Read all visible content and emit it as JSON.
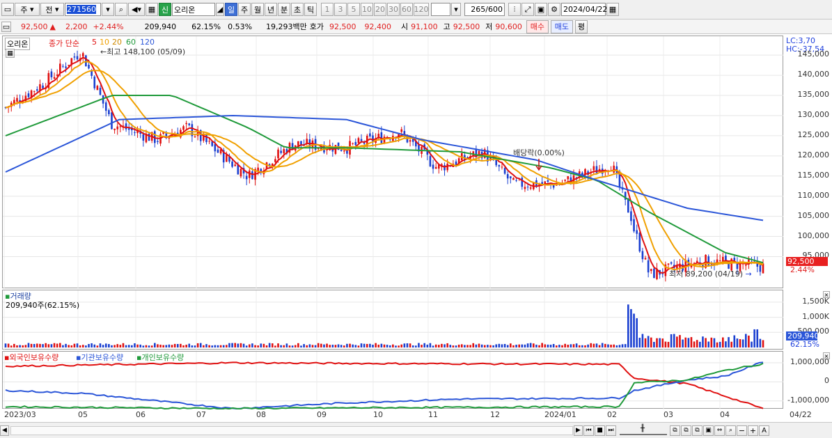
{
  "toolbar": {
    "period_label": "주",
    "prev_label": "전",
    "code": "271560",
    "credit_badge": "신",
    "stock_name": "오리온",
    "periods": [
      "일",
      "주",
      "월",
      "년",
      "분",
      "초",
      "틱"
    ],
    "active_period": "일",
    "intervals": [
      "1",
      "3",
      "5",
      "10",
      "20",
      "30",
      "60",
      "120"
    ],
    "count_value": "265",
    "count_total": "/600",
    "date": "2024/04/22"
  },
  "info": {
    "price": "92,500",
    "change_arrow": "▲",
    "change": "2,200",
    "change_pct": "+2.44%",
    "volume": "209,940",
    "turnover": "62.15%",
    "ratio": "0.53%",
    "amount": "19,293백만",
    "quote_label": "호가",
    "ask": "92,500",
    "bid": "92,400",
    "open_label": "시",
    "open": "91,100",
    "high_label": "고",
    "high": "92,500",
    "low_label": "저",
    "low": "90,600",
    "buy_button": "매수",
    "sell_button": "매도",
    "eval_button": "평"
  },
  "price_pane": {
    "name_tab": "오리온",
    "legend_prefix": "종가 단순",
    "ma_periods": [
      "5",
      "10",
      "20",
      "60",
      "120"
    ],
    "ma_colors": [
      "#e01010",
      "#f0a000",
      "#f0a000",
      "#1f9a3a",
      "#2a55d8"
    ],
    "high_note": "최고 148,100 (05/09)",
    "low_note": "최저 89,200 (04/19)",
    "dividend_note": "배당락(0.00%)",
    "lc": "LC:3,70",
    "hc": "HC:-37,54",
    "last_price_tag": "92,500",
    "last_pct_tag": "2.44%",
    "y_labels": [
      "145,000",
      "140,000",
      "135,000",
      "130,000",
      "125,000",
      "120,000",
      "115,000",
      "110,000",
      "105,000",
      "100,000",
      "95,000"
    ]
  },
  "volume_pane": {
    "title": "거래량",
    "value_note": "209,940주(62.15%)",
    "y_labels": [
      "1,500K",
      "1,000K",
      "500,000"
    ],
    "last_tag": "209,940",
    "pct_tag": "62.15%"
  },
  "holdings_pane": {
    "legends": [
      "외국인보유수량",
      "기관보유수량",
      "개인보유수량"
    ],
    "legend_colors": [
      "#e01010",
      "#2a55d8",
      "#1f9a3a"
    ],
    "y_labels": [
      "1,000,000",
      "0",
      "-1,000,000"
    ]
  },
  "x_axis": {
    "labels": [
      "2023/03",
      "05",
      "06",
      "07",
      "08",
      "09",
      "10",
      "11",
      "12",
      "2024/01",
      "02",
      "03",
      "04"
    ],
    "end_label": "04/22"
  },
  "chart_data": {
    "type": "candlestick",
    "title": "오리온",
    "ylim": [
      88000,
      149000
    ],
    "series": [
      {
        "name": "종가 단순 5",
        "approx_path": [
          [
            0,
            132000
          ],
          [
            0.05,
            138000
          ],
          [
            0.1,
            146000
          ],
          [
            0.14,
            128000
          ],
          [
            0.2,
            124000
          ],
          [
            0.24,
            127000
          ],
          [
            0.28,
            121000
          ],
          [
            0.32,
            115000
          ],
          [
            0.38,
            123000
          ],
          [
            0.45,
            122000
          ],
          [
            0.52,
            126000
          ],
          [
            0.57,
            117000
          ],
          [
            0.63,
            121000
          ],
          [
            0.67,
            113000
          ],
          [
            0.73,
            113000
          ],
          [
            0.8,
            118000
          ],
          [
            0.85,
            90500
          ],
          [
            0.92,
            94000
          ],
          [
            1,
            92500
          ]
        ]
      },
      {
        "name": "60",
        "approx_path": [
          [
            0,
            125000
          ],
          [
            0.14,
            135000
          ],
          [
            0.22,
            135000
          ],
          [
            0.32,
            127000
          ],
          [
            0.37,
            122000
          ],
          [
            0.45,
            122000
          ],
          [
            0.6,
            121000
          ],
          [
            0.72,
            117000
          ],
          [
            0.78,
            114000
          ],
          [
            0.85,
            106000
          ],
          [
            0.95,
            96000
          ],
          [
            1,
            93500
          ]
        ]
      },
      {
        "name": "120",
        "approx_path": [
          [
            0,
            116000
          ],
          [
            0.15,
            129000
          ],
          [
            0.3,
            130000
          ],
          [
            0.45,
            129000
          ],
          [
            0.55,
            124000
          ],
          [
            0.7,
            119000
          ],
          [
            0.78,
            114000
          ],
          [
            0.9,
            107000
          ],
          [
            1,
            104000
          ]
        ]
      }
    ],
    "annotations": {
      "high": 148100,
      "high_date": "05/09",
      "low": 89200,
      "low_date": "04/19",
      "last": 92500
    }
  }
}
